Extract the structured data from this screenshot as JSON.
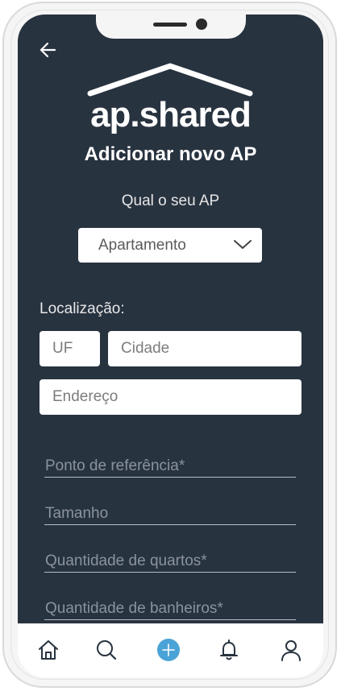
{
  "header": {
    "back_icon": "arrow-left-icon"
  },
  "logo": {
    "text": "ap.shared",
    "roof_icon": "house-roof-icon"
  },
  "page": {
    "title": "Adicionar novo AP",
    "question": "Qual o seu AP"
  },
  "property_type": {
    "selected": "Apartamento",
    "icon": "chevron-down-icon"
  },
  "location": {
    "label": "Localização:",
    "uf_placeholder": "UF",
    "city_placeholder": "Cidade",
    "address_placeholder": "Endereço"
  },
  "details": {
    "reference_placeholder": "Ponto de referência*",
    "size_placeholder": "Tamanho",
    "bedrooms_placeholder": "Quantidade de quartos*",
    "bathrooms_placeholder": "Quantidade de banheiros*"
  },
  "tabbar": {
    "items": [
      "home-icon",
      "search-icon",
      "add-icon",
      "bell-icon",
      "user-icon"
    ],
    "accent": "#4aa3d6"
  },
  "colors": {
    "background": "#283340",
    "text": "#ffffff"
  }
}
